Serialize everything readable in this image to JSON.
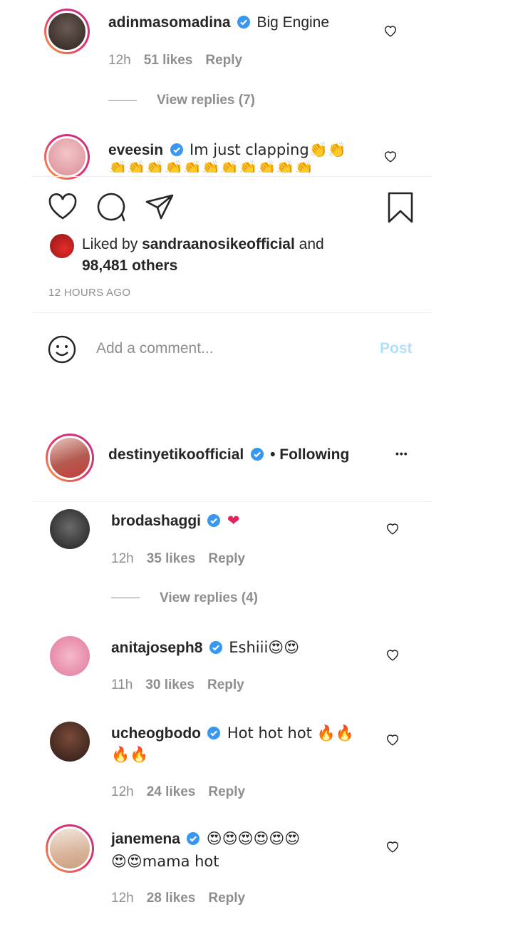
{
  "post1": {
    "comments": [
      {
        "username": "adinmasomadina",
        "text": "Big Engine",
        "time": "12h",
        "likes": "51 likes",
        "reply": "Reply",
        "view_replies": "View replies (7)"
      },
      {
        "username": "eveesin",
        "text": "Im just clapping👏👏",
        "text2": "👏👏👏👏👏👏👏👏👏👏👏"
      }
    ],
    "liked_by_prefix": "Liked by ",
    "liked_by_user": "sandraanosikeofficial",
    "liked_by_and": " and",
    "liked_by_others": "98,481 others",
    "timestamp": "12 HOURS AGO",
    "add_comment_placeholder": "Add a comment...",
    "post_label": "Post"
  },
  "post2": {
    "author": "destinyetikoofficial",
    "following": "• Following",
    "more": "•••",
    "comments": [
      {
        "username": "brodashaggi",
        "text": "❤",
        "time": "12h",
        "likes": "35 likes",
        "reply": "Reply",
        "view_replies": "View replies (4)"
      },
      {
        "username": "anitajoseph8",
        "text": "Eshiii😍😍",
        "time": "11h",
        "likes": "30 likes",
        "reply": "Reply"
      },
      {
        "username": "ucheogbodo",
        "text": "Hot hot hot 🔥🔥",
        "text2": "🔥🔥",
        "time": "12h",
        "likes": "24 likes",
        "reply": "Reply"
      },
      {
        "username": "janemena",
        "text": "😍😍😍😍😍😍",
        "text2": "😍😍mama hot",
        "time": "12h",
        "likes": "28 likes",
        "reply": "Reply"
      }
    ]
  },
  "colors": {
    "verified": "#3897f0",
    "post_disabled": "#b2dffc",
    "meta": "#8e8e8e",
    "heart": "#ed4956"
  }
}
